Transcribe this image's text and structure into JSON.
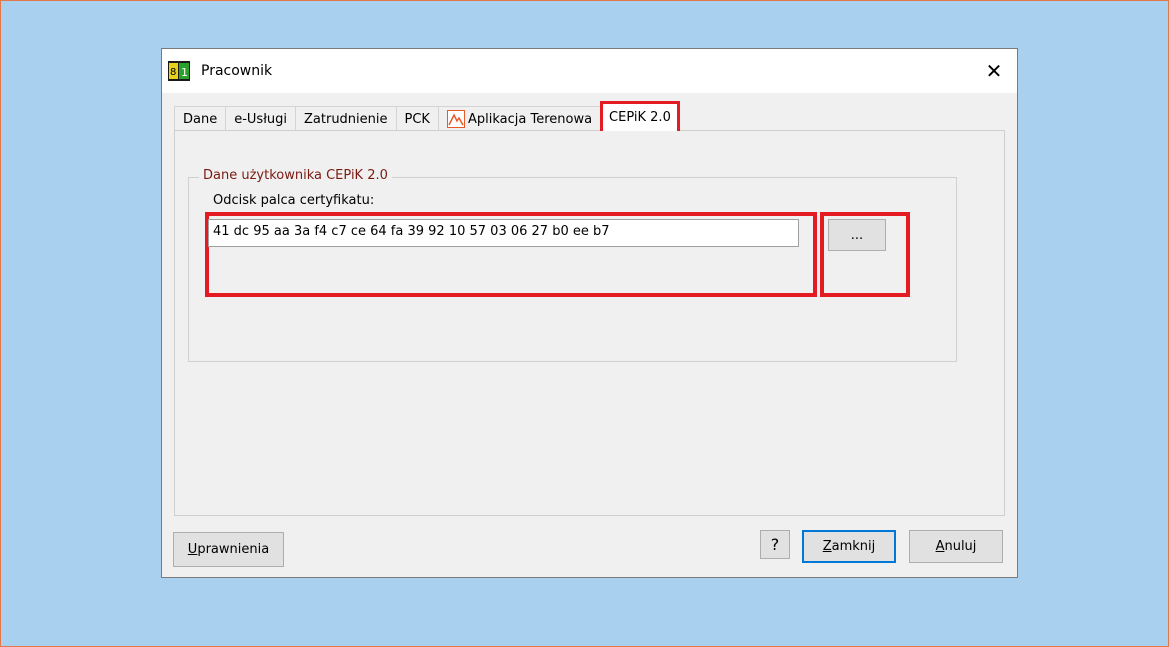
{
  "window": {
    "title": "Pracownik"
  },
  "tabs": [
    {
      "label": "Dane"
    },
    {
      "label": "e-Usługi"
    },
    {
      "label": "Zatrudnienie"
    },
    {
      "label": "PCK"
    },
    {
      "label": "Aplikacja Terenowa",
      "icon": "aplikacja-terenowa-icon"
    },
    {
      "label": "CEPiK 2.0",
      "active": true
    }
  ],
  "group": {
    "legend": "Dane użytkownika CEPiK 2.0",
    "fingerprint_label": "Odcisk palca certyfikatu:",
    "fingerprint_value": "41 dc 95 aa 3a f4 c7 ce 64 fa 39 92 10 57 03 06 27 b0 ee b7",
    "browse_label": "..."
  },
  "buttons": {
    "permissions_first": "U",
    "permissions_rest": "prawnienia",
    "help": "?",
    "close_first": "Z",
    "close_rest": "amknij",
    "cancel_first": "A",
    "cancel_rest": "nuluj"
  },
  "colors": {
    "highlight": "#e41b23",
    "background": "#a9d1ef",
    "legend": "#7a1b12"
  }
}
